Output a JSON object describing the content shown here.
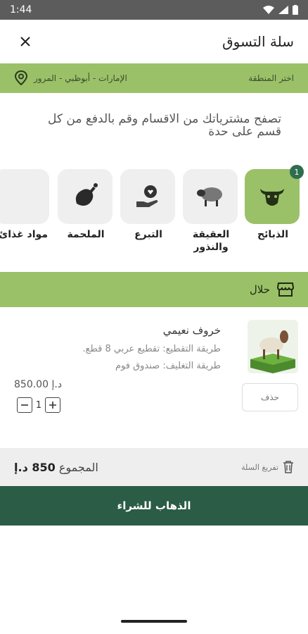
{
  "status": {
    "time": "1:44"
  },
  "header": {
    "title": "سلة التسوق"
  },
  "region": {
    "label": "اختر المنطقة",
    "value": "الإمارات - أبوظبي - المرور"
  },
  "intro": {
    "text": "تصفح مشترياتك من الاقسام وقم بالدفع من كل قسم على حدة"
  },
  "categories": [
    {
      "label": "الذبائح",
      "icon": "cow-head-icon",
      "badge": "1"
    },
    {
      "label": "العقيقة والنذور",
      "icon": "sheep-icon"
    },
    {
      "label": "التبرع",
      "icon": "donate-hand-icon"
    },
    {
      "label": "الملحمة",
      "icon": "meat-leg-icon"
    },
    {
      "label": "مواد غذائ",
      "icon": "food-icon"
    }
  ],
  "vendor": {
    "name": "حلال",
    "icon": "store-icon"
  },
  "item": {
    "name": "خروف نعيمي",
    "cut": "طريقة التقطيع: تقطيع عربي 8 قطع.",
    "pack": "طريقة التغليف: صندوق فوم",
    "price": "850.00 د.إ",
    "qty": "1",
    "delete_label": "حذف"
  },
  "footer": {
    "clear_label": "تفريغ السلة",
    "total_label": "المجموع",
    "total_value": "850 د.إ"
  },
  "checkout": {
    "label": "الذهاب للشراء"
  },
  "colors": {
    "accent": "#9bc168",
    "dark": "#2b5c45",
    "badge": "#2f6d4f"
  }
}
